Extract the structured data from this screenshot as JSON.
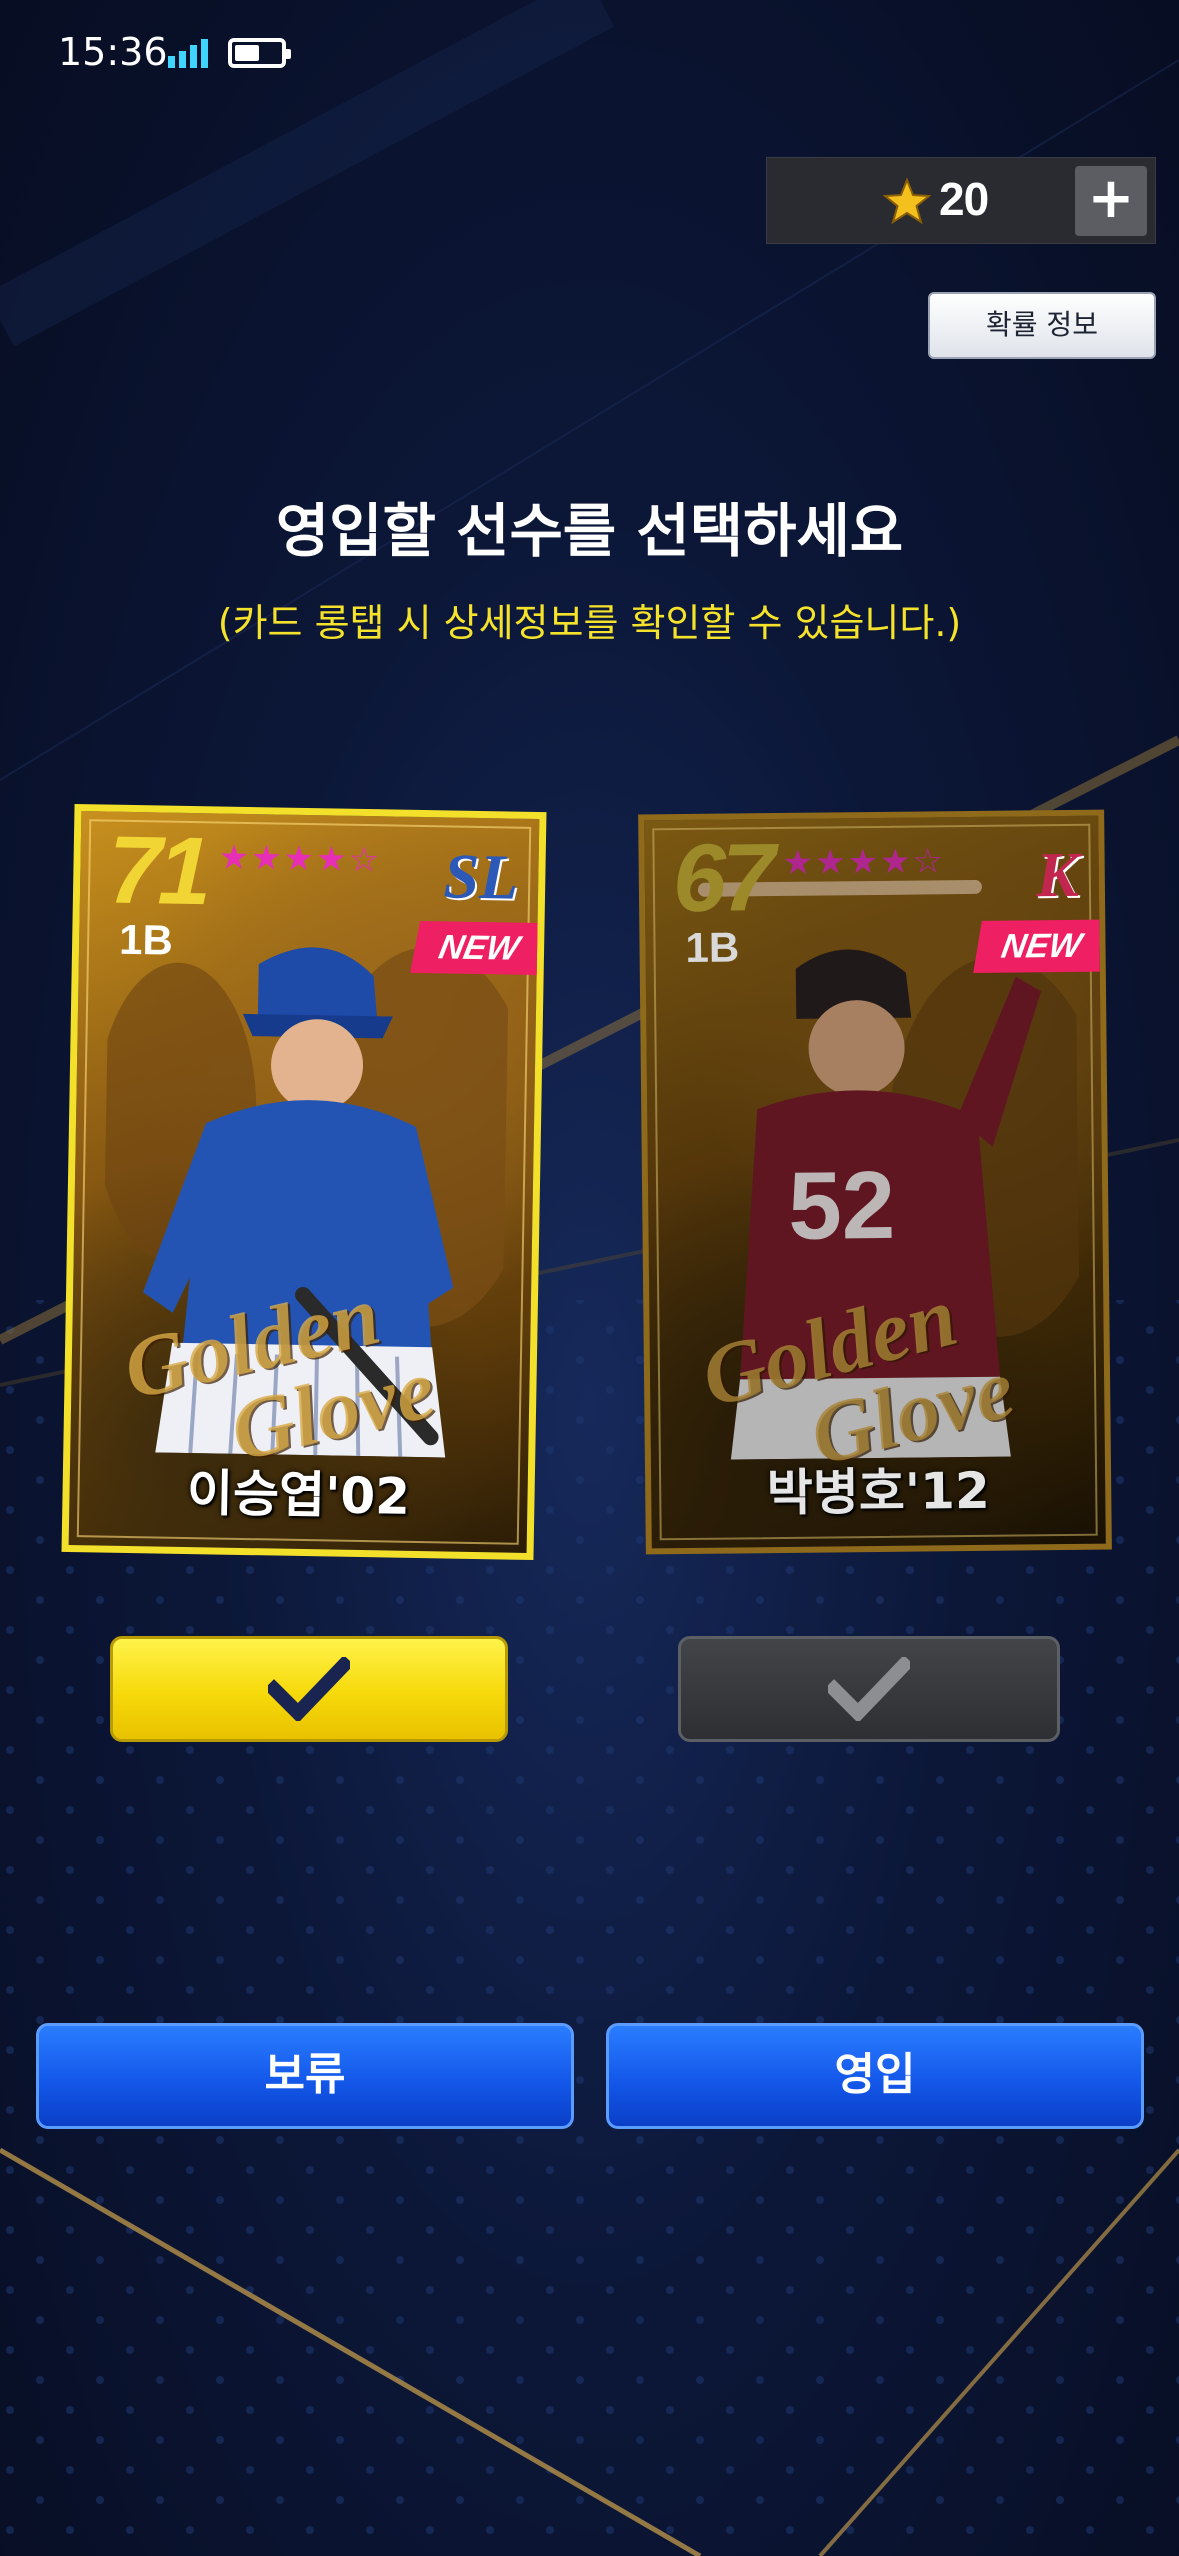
{
  "status_bar": {
    "time": "15:36",
    "battery_level": 0.55
  },
  "currency": {
    "icon": "star-icon",
    "value": "20",
    "add_icon": "plus-icon"
  },
  "probability_button": "확률 정보",
  "title": "영입할 선수를 선택하세요",
  "subtitle": "(카드 롱탭 시 상세정보를 확인할 수 있습니다.)",
  "cards": [
    {
      "rating": "71",
      "position": "1B",
      "stars": 5,
      "team_logo": "SL",
      "badge": "NEW",
      "watermark_line1": "Golden",
      "watermark_line2": "Glove",
      "name": "이승엽'02",
      "selected": true
    },
    {
      "rating": "67",
      "position": "1B",
      "stars": 5,
      "team_logo": "K",
      "badge": "NEW",
      "watermark_line1": "Golden",
      "watermark_line2": "Glove",
      "name": "박병호'12",
      "selected": false
    }
  ],
  "buttons": {
    "hold": "보류",
    "recruit": "영입"
  },
  "colors": {
    "accent_yellow": "#f6d90a",
    "button_blue": "#1458ea",
    "badge_pink": "#ee1f63"
  }
}
